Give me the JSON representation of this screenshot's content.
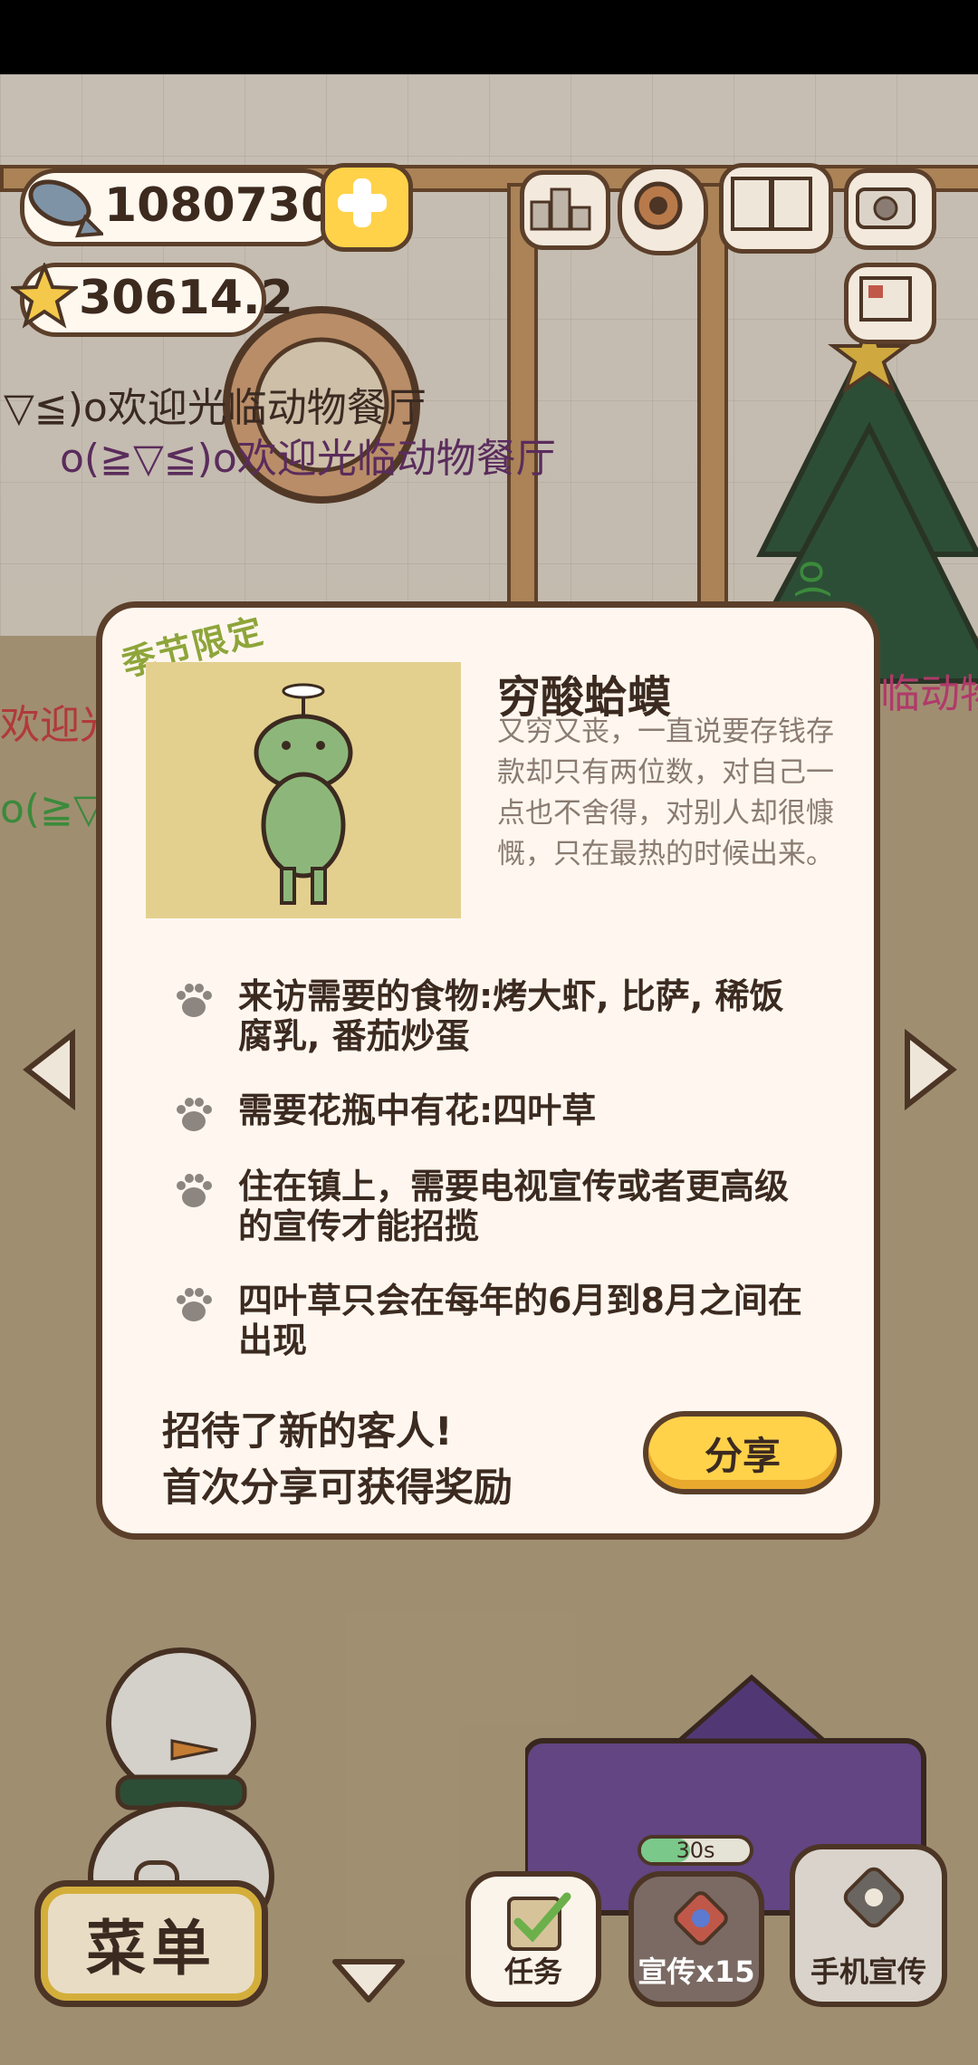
{
  "currency": {
    "fish": "1080730",
    "stars": "30614.2"
  },
  "marquee": {
    "line1": "▽≦)o欢迎光临动物餐厅",
    "line2": "o(≧▽≦)o欢迎光临动物餐厅",
    "side_left": "欢迎光",
    "side_right": "临动物",
    "side_emote_left": "o(≧▽",
    "side_emote_right": "o(≧▽≦"
  },
  "modal": {
    "tag": "季节限定",
    "name": "穷酸蛤蟆",
    "description": "又穷又丧，一直说要存钱存款却只有两位数，对自己一点也不舍得，对别人却很慷慨，只在最热的时候出来。",
    "requirements": [
      "来访需要的食物:烤大虾, 比萨, 稀饭腐乳, 番茄炒蛋",
      "需要花瓶中有花:四叶草",
      "住在镇上，需要电视宣传或者更高级的宣传才能招揽",
      "四叶草只会在每年的6月到8月之间在出现"
    ],
    "invite_line1": "招待了新的客人!",
    "invite_line2": "首次分享可获得奖励",
    "share_label": "分享"
  },
  "bottom": {
    "menu_label": "菜单",
    "tasks_label": "任务",
    "promo_label": "宣传x15",
    "phone_label": "手机宣传",
    "timer": "30s",
    "timer_progress": 0.45
  },
  "icons": {
    "fish": "fish-icon",
    "plus": "plus-icon",
    "star": "star-icon",
    "rank": "ranking-icon",
    "settings": "gear-icon",
    "book": "recipe-book-icon",
    "camera": "camera-icon",
    "newspaper": "newspaper-icon",
    "paw": "paw-icon"
  },
  "colors": {
    "accent": "#ffd24a",
    "outline": "#5b3f2a",
    "panel": "#fff7ef",
    "season_tag": "#8ea53a"
  }
}
